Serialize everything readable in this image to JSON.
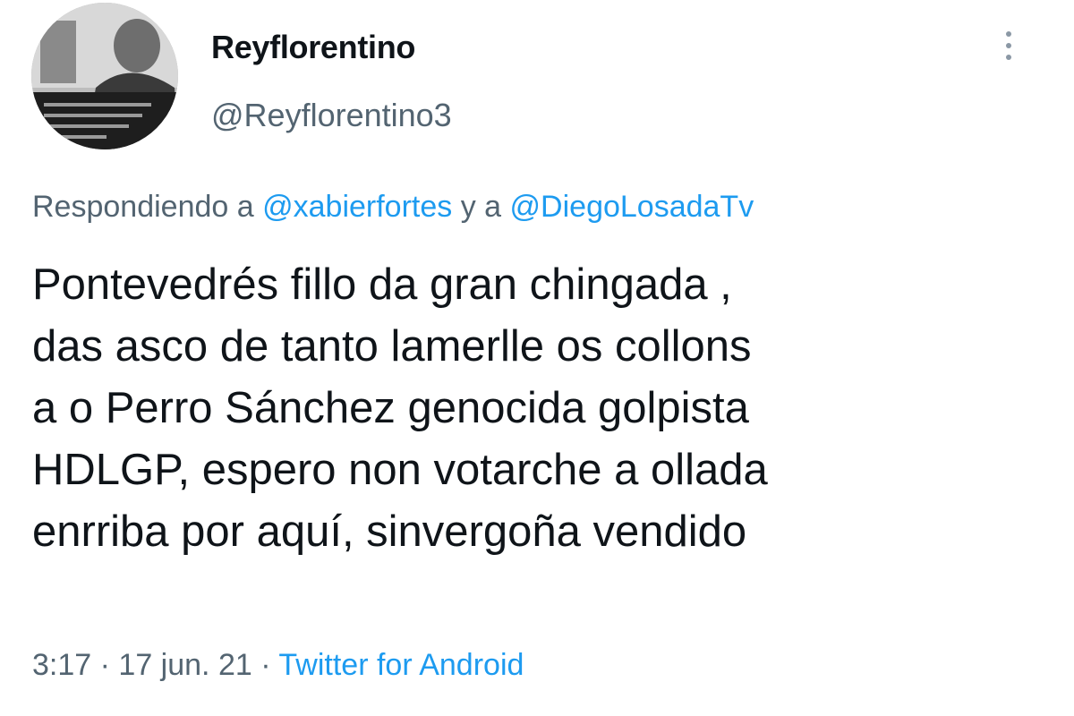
{
  "author": {
    "display_name": "Reyflorentino",
    "handle": "@Reyflorentino3"
  },
  "reply": {
    "prefix": "Respondiendo a",
    "mention_1": "@xabierfortes",
    "joiner": "y a",
    "mention_2": "@DiegoLosadaTv"
  },
  "tweet": {
    "lines": [
      "Pontevedrés fillo da gran chingada ,",
      "das asco de tanto lamerlle os collons",
      "a o Perro Sánchez genocida golpista",
      "HDLGP, espero non votarche a ollada",
      "enrriba por aquí, sinvergoña vendido"
    ]
  },
  "meta": {
    "time": "3:17",
    "separator": "·",
    "date": "17 jun. 21",
    "source": "Twitter for Android"
  },
  "icons": {
    "more": "more-vertical-icon",
    "avatar": "profile-photo"
  },
  "colors": {
    "link": "#1d9bf0",
    "secondary_text": "#536471",
    "primary_text": "#0f1419"
  }
}
